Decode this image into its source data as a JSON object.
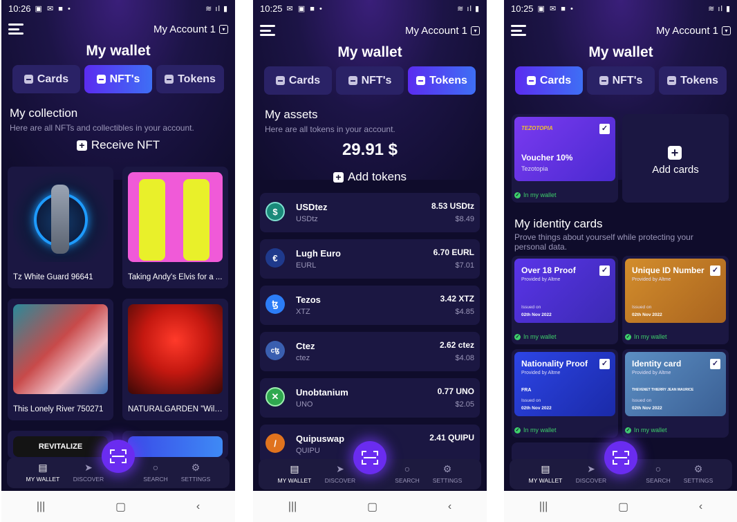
{
  "screens": [
    {
      "status_time": "10:26",
      "account": "My Account 1",
      "title": "My wallet",
      "tabs": [
        {
          "label": "Cards"
        },
        {
          "label": "NFT's"
        },
        {
          "label": "Tokens"
        }
      ],
      "active_tab": "NFT's",
      "section_title": "My collection",
      "section_sub": "Here are all NFTs and collectibles in your account.",
      "action": "Receive NFT",
      "nfts": [
        {
          "name": "Tz White Guard 96641"
        },
        {
          "name": "Taking Andy's Elvis for a ..."
        },
        {
          "name": "This Lonely River 750271"
        },
        {
          "name": "NATURALGARDEN \"Wild..."
        }
      ],
      "partial_label": "REVITALIZE"
    },
    {
      "status_time": "10:25",
      "account": "My Account 1",
      "title": "My wallet",
      "tabs": [
        {
          "label": "Cards"
        },
        {
          "label": "NFT's"
        },
        {
          "label": "Tokens"
        }
      ],
      "active_tab": "Tokens",
      "section_title": "My assets",
      "section_sub": "Here are all tokens in your account.",
      "balance": "29.91 $",
      "action": "Add tokens",
      "tokens": [
        {
          "name": "USDtez",
          "symbol": "USDtz",
          "amount": "8.53 USDtz",
          "usd": "$8.49",
          "color": "#1a8a7a",
          "glyph": "$"
        },
        {
          "name": "Lugh Euro",
          "symbol": "EURL",
          "amount": "6.70 EURL",
          "usd": "$7.01",
          "color": "#1f3a8c",
          "glyph": "€"
        },
        {
          "name": "Tezos",
          "symbol": "XTZ",
          "amount": "3.42 XTZ",
          "usd": "$4.85",
          "color": "#2c7df7",
          "glyph": "ꜩ"
        },
        {
          "name": "Ctez",
          "symbol": "ctez",
          "amount": "2.62 ctez",
          "usd": "$4.08",
          "color": "#3a5fb0",
          "glyph": "cꜩ"
        },
        {
          "name": "Unobtanium",
          "symbol": "UNO",
          "amount": "0.77 UNO",
          "usd": "$2.05",
          "color": "#2fa84f",
          "glyph": "✕"
        },
        {
          "name": "Quipuswap",
          "symbol": "QUIPU",
          "amount": "2.41 QUIPU",
          "usd": "",
          "color": "#e0731e",
          "glyph": "/"
        }
      ]
    },
    {
      "status_time": "10:25",
      "account": "My Account 1",
      "title": "My wallet",
      "tabs": [
        {
          "label": "Cards"
        },
        {
          "label": "NFT's"
        },
        {
          "label": "Tokens"
        }
      ],
      "active_tab": "Cards",
      "voucher": {
        "title": "Voucher 10%",
        "issuer": "Tezotopia",
        "logo": "TEZOTOPIA",
        "status": "In my wallet"
      },
      "add_cards": "Add cards",
      "section_title": "My identity cards",
      "section_sub": "Prove things about yourself while protecting your personal data.",
      "identity": [
        {
          "title": "Over 18 Proof",
          "provider": "Provided by Altme",
          "extra": "",
          "issued_label": "Issued on",
          "issued": "02th Nov 2022",
          "status": "In my wallet",
          "color1": "#5a34e8",
          "color2": "#3b2ab3"
        },
        {
          "title": "Unique ID Number",
          "provider": "Provided by Altme",
          "extra": "",
          "issued_label": "Issued on",
          "issued": "02th Nov 2022",
          "status": "In my wallet",
          "color1": "#d38d2c",
          "color2": "#a9641f"
        },
        {
          "title": "Nationality Proof",
          "provider": "Provided by Altme",
          "extra": "FRA",
          "issued_label": "Issued on",
          "issued": "02th Nov 2022",
          "status": "In my wallet",
          "color1": "#2d45e6",
          "color2": "#1a2aa8"
        },
        {
          "title": "Identity card",
          "provider": "Provided by Altme",
          "extra": "THEVENET THIERRY JEAN MAURICE",
          "issued_label": "Issued on",
          "issued": "02th Nov 2022",
          "status": "In my wallet",
          "color1": "#5c8fc4",
          "color2": "#3a5f94"
        }
      ]
    }
  ],
  "bottom_nav": [
    {
      "label": "MY WALLET",
      "icon": "wallet-icon"
    },
    {
      "label": "DISCOVER",
      "icon": "paper-plane-icon"
    },
    {
      "label": "SEARCH",
      "icon": "search-icon"
    },
    {
      "label": "SETTINGS",
      "icon": "gear-icon"
    }
  ],
  "colors": {
    "background": "#0f0c2b",
    "card": "#1b1742",
    "accent": "#5b2cf0",
    "success": "#3ecf6b"
  }
}
